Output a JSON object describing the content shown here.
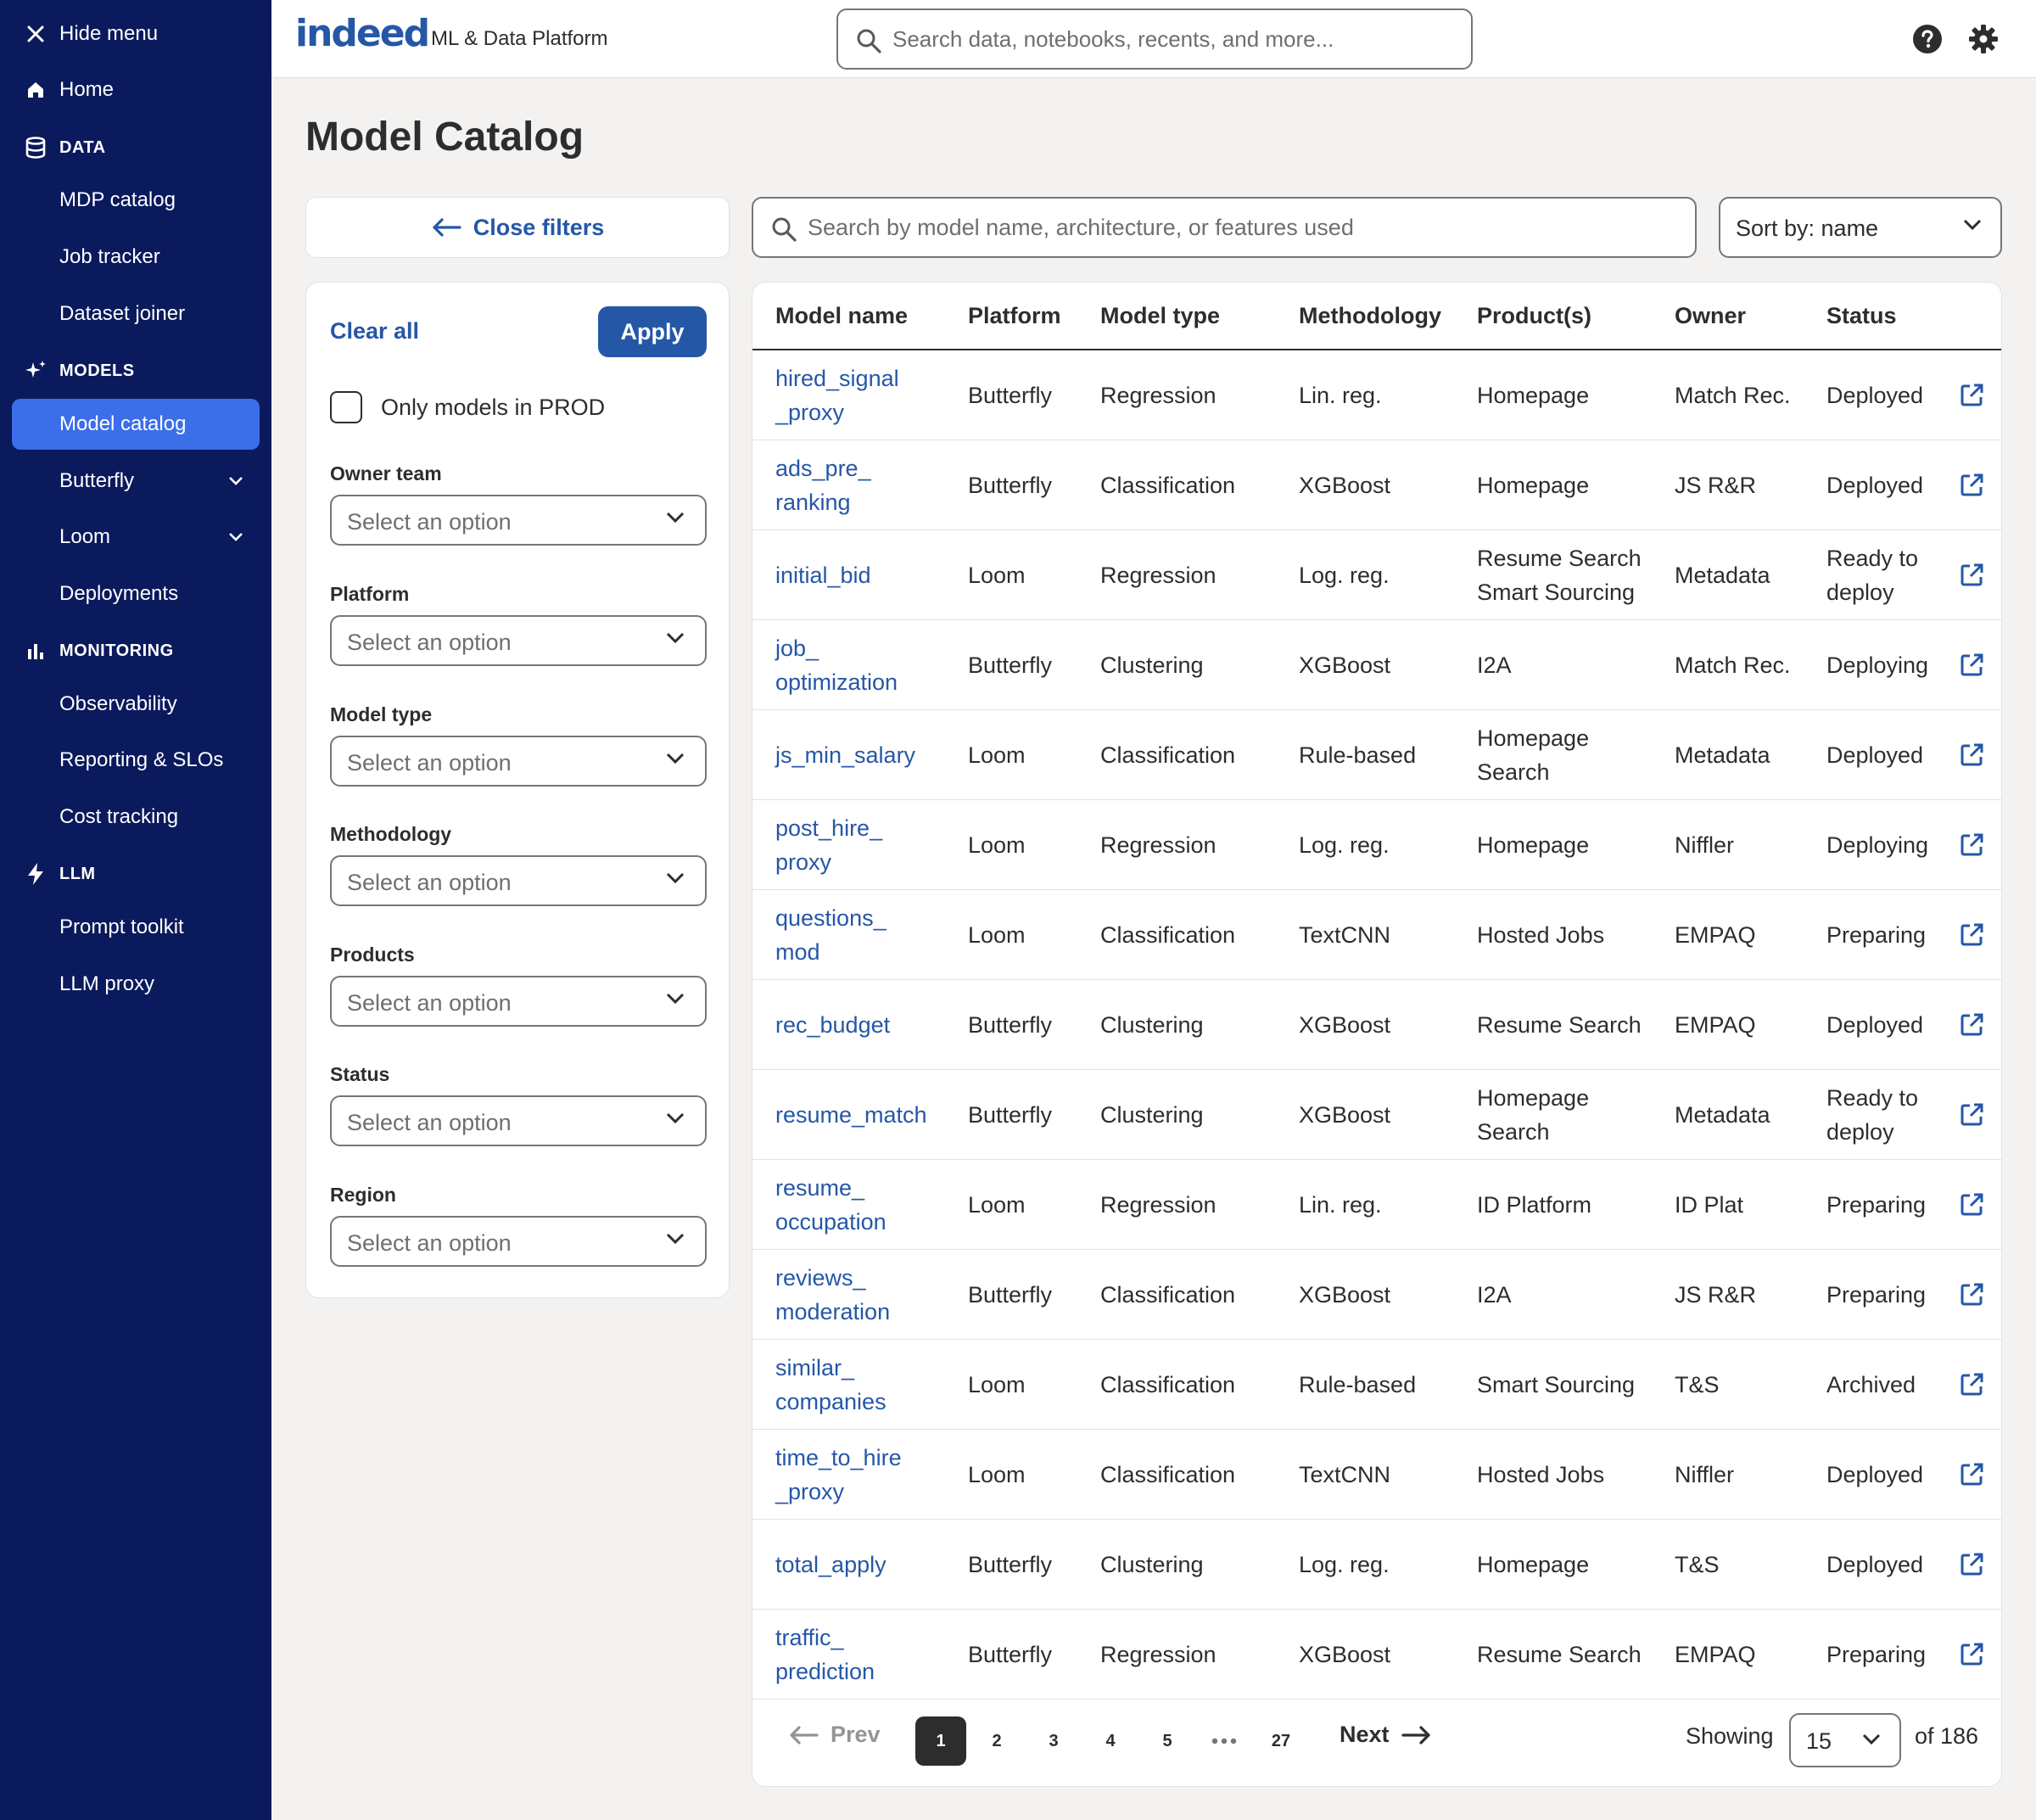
{
  "sidebar": {
    "hide_menu": "Hide menu",
    "home": "Home",
    "sections": {
      "data": "DATA",
      "models": "MODELS",
      "monitoring": "MONITORING",
      "llm": "LLM"
    },
    "items": {
      "mdp_catalog": "MDP catalog",
      "job_tracker": "Job tracker",
      "dataset_joiner": "Dataset joiner",
      "model_catalog": "Model catalog",
      "butterfly": "Butterfly",
      "loom": "Loom",
      "deployments": "Deployments",
      "observability": "Observability",
      "reporting": "Reporting & SLOs",
      "cost_tracking": "Cost tracking",
      "prompt_toolkit": "Prompt toolkit",
      "llm_proxy": "LLM proxy"
    }
  },
  "header": {
    "logo": "indeed",
    "platform": "ML & Data Platform",
    "search_placeholder": "Search data, notebooks, recents, and more..."
  },
  "page": {
    "title": "Model Catalog",
    "close_filters": "Close filters",
    "search_placeholder": "Search by model name, architecture, or features used",
    "sort_label": "Sort by: name"
  },
  "filters": {
    "clear_all": "Clear all",
    "apply": "Apply",
    "prod_only": "Only models in PROD",
    "placeholder": "Select an option",
    "owner_team": "Owner team",
    "platform": "Platform",
    "model_type": "Model type",
    "methodology": "Methodology",
    "products": "Products",
    "status": "Status",
    "region": "Region"
  },
  "table": {
    "headers": {
      "name": "Model name",
      "platform": "Platform",
      "type": "Model type",
      "methodology": "Methodology",
      "products": "Product(s)",
      "owner": "Owner",
      "status": "Status"
    },
    "rows": [
      {
        "name": "hired_signal\n_proxy",
        "platform": "Butterfly",
        "type": "Regression",
        "methodology": "Lin. reg.",
        "products": "Homepage",
        "owner": "Match Rec.",
        "status": "Deployed"
      },
      {
        "name": "ads_pre_\nranking",
        "platform": "Butterfly",
        "type": "Classification",
        "methodology": "XGBoost",
        "products": "Homepage",
        "owner": "JS R&R",
        "status": "Deployed"
      },
      {
        "name": "initial_bid",
        "platform": "Loom",
        "type": "Regression",
        "methodology": "Log. reg.",
        "products": "Resume Search\nSmart Sourcing",
        "owner": "Metadata",
        "status": "Ready to\ndeploy"
      },
      {
        "name": "job_\noptimization",
        "platform": "Butterfly",
        "type": "Clustering",
        "methodology": "XGBoost",
        "products": "I2A",
        "owner": "Match Rec.",
        "status": "Deploying"
      },
      {
        "name": "js_min_salary",
        "platform": "Loom",
        "type": "Classification",
        "methodology": "Rule-based",
        "products": "Homepage\nSearch",
        "owner": "Metadata",
        "status": "Deployed"
      },
      {
        "name": "post_hire_\nproxy",
        "platform": "Loom",
        "type": "Regression",
        "methodology": "Log. reg.",
        "products": "Homepage",
        "owner": "Niffler",
        "status": "Deploying"
      },
      {
        "name": "questions_\nmod",
        "platform": "Loom",
        "type": "Classification",
        "methodology": "TextCNN",
        "products": "Hosted Jobs",
        "owner": "EMPAQ",
        "status": "Preparing"
      },
      {
        "name": "rec_budget",
        "platform": "Butterfly",
        "type": "Clustering",
        "methodology": "XGBoost",
        "products": "Resume Search",
        "owner": "EMPAQ",
        "status": "Deployed"
      },
      {
        "name": "resume_match",
        "platform": "Butterfly",
        "type": "Clustering",
        "methodology": "XGBoost",
        "products": "Homepage\nSearch",
        "owner": "Metadata",
        "status": "Ready to\ndeploy"
      },
      {
        "name": "resume_\noccupation",
        "platform": "Loom",
        "type": "Regression",
        "methodology": "Lin. reg.",
        "products": "ID Platform",
        "owner": "ID Plat",
        "status": "Preparing"
      },
      {
        "name": "reviews_\nmoderation",
        "platform": "Butterfly",
        "type": "Classification",
        "methodology": "XGBoost",
        "products": "I2A",
        "owner": "JS R&R",
        "status": "Preparing"
      },
      {
        "name": "similar_\ncompanies",
        "platform": "Loom",
        "type": "Classification",
        "methodology": "Rule-based",
        "products": "Smart Sourcing",
        "owner": "T&S",
        "status": "Archived"
      },
      {
        "name": "time_to_hire\n_proxy",
        "platform": "Loom",
        "type": "Classification",
        "methodology": "TextCNN",
        "products": "Hosted Jobs",
        "owner": "Niffler",
        "status": "Deployed"
      },
      {
        "name": "total_apply",
        "platform": "Butterfly",
        "type": "Clustering",
        "methodology": "Log. reg.",
        "products": "Homepage",
        "owner": "T&S",
        "status": "Deployed"
      },
      {
        "name": "traffic_\nprediction",
        "platform": "Butterfly",
        "type": "Regression",
        "methodology": "XGBoost",
        "products": "Resume Search",
        "owner": "EMPAQ",
        "status": "Preparing"
      }
    ]
  },
  "pagination": {
    "prev": "Prev",
    "next": "Next",
    "pages": [
      "1",
      "2",
      "3",
      "4",
      "5",
      "27"
    ],
    "current": "1",
    "showing": "Showing",
    "per_page": "15",
    "of_total": "of 186"
  },
  "colors": {
    "sidebar_bg": "#0a1a5c",
    "active_item": "#3b6ee8",
    "brand_blue": "#2557a7"
  }
}
